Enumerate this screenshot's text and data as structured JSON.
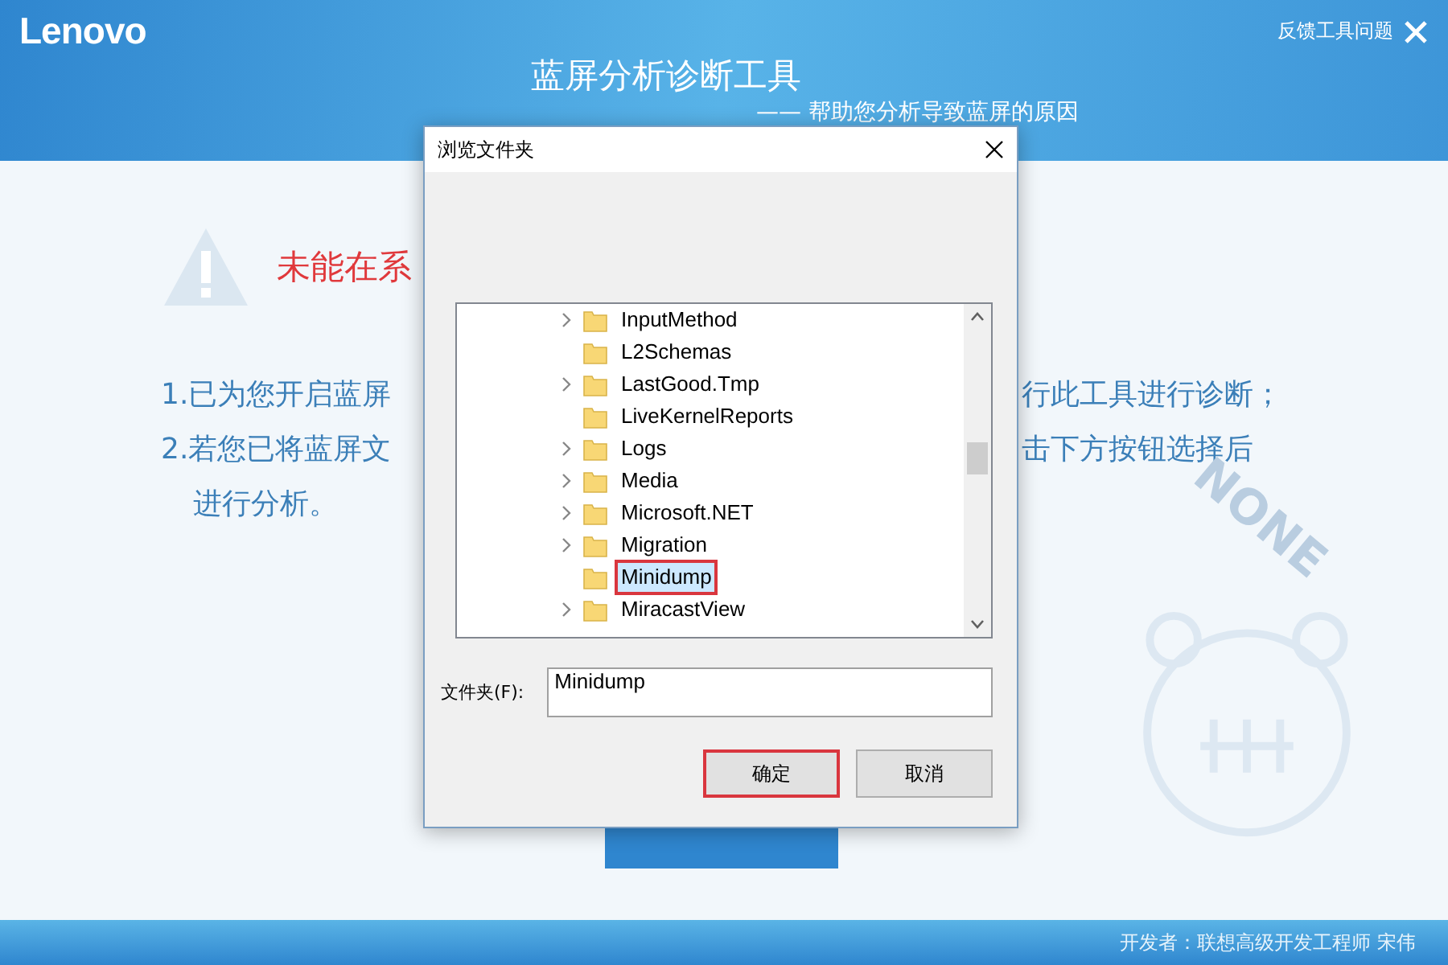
{
  "header": {
    "logo": "Lenovo",
    "feedback_link": "反馈工具问题",
    "title": "蓝屏分析诊断工具",
    "subtitle": "—— 帮助您分析导致蓝屏的原因"
  },
  "main": {
    "warning": "未能在系",
    "lines": [
      {
        "left": "1.已为您开启蓝屏",
        "right": "行此工具进行诊断；",
        "indent": false
      },
      {
        "left": "2.若您已将蓝屏文",
        "right": "击下方按钮选择后",
        "indent": false
      },
      {
        "left": "进行分析。",
        "indent": true
      }
    ],
    "mascot_text": "NONE"
  },
  "dialog": {
    "title": "浏览文件夹",
    "tree": [
      {
        "label": "InputMethod",
        "expandable": true,
        "selected": false,
        "highlighted": false
      },
      {
        "label": "L2Schemas",
        "expandable": false,
        "selected": false,
        "highlighted": false
      },
      {
        "label": "LastGood.Tmp",
        "expandable": true,
        "selected": false,
        "highlighted": false
      },
      {
        "label": "LiveKernelReports",
        "expandable": false,
        "selected": false,
        "highlighted": false
      },
      {
        "label": "Logs",
        "expandable": true,
        "selected": false,
        "highlighted": false
      },
      {
        "label": "Media",
        "expandable": true,
        "selected": false,
        "highlighted": false
      },
      {
        "label": "Microsoft.NET",
        "expandable": true,
        "selected": false,
        "highlighted": false
      },
      {
        "label": "Migration",
        "expandable": true,
        "selected": false,
        "highlighted": false
      },
      {
        "label": "Minidump",
        "expandable": false,
        "selected": true,
        "highlighted": true
      },
      {
        "label": "MiracastView",
        "expandable": true,
        "selected": false,
        "highlighted": false
      }
    ],
    "folder_label": "文件夹(F):",
    "folder_value": "Minidump",
    "buttons": [
      {
        "label": "确定",
        "highlighted": true
      },
      {
        "label": "取消",
        "highlighted": false
      }
    ]
  },
  "footer": {
    "credit": "开发者：联想高级开发工程师 宋伟"
  }
}
